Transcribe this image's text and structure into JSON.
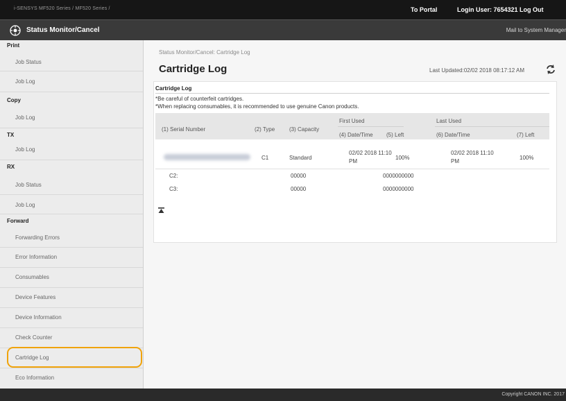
{
  "topbar": {
    "product": "i-SENSYS   MF520 Series / MF520 Series /",
    "portal": "To Portal",
    "login": "Login User:  7654321  Log Out"
  },
  "subbar": {
    "title": "Status Monitor/Cancel",
    "mail": "Mail to System Manager"
  },
  "sidebar": {
    "print": "Print",
    "print_job_status": "Job Status",
    "print_job_log": "Job Log",
    "copy": "Copy",
    "copy_job_log": "Job Log",
    "tx": "TX",
    "tx_job_log": "Job Log",
    "rx": "RX",
    "rx_job_status": "Job Status",
    "rx_job_log": "Job Log",
    "forward": "Forward",
    "forward_errors": "Forwarding Errors",
    "error_information": "Error Information",
    "consumables": "Consumables",
    "device_features": "Device Features",
    "device_information": "Device Information",
    "check_counter": "Check Counter",
    "cartridge_log": "Cartridge Log",
    "eco_information": "Eco Information"
  },
  "main": {
    "breadcrumb": "Status Monitor/Cancel: Cartridge Log",
    "title": "Cartridge Log",
    "last_updated": "Last Updated:02/02 2018 08:17:12 AM",
    "section_title": "Cartridge Log",
    "note1": "*Be careful of counterfeit cartridges.",
    "note2": "*When replacing consumables, it is recommended to use genuine Canon products."
  },
  "table": {
    "h_serial": "(1) Serial Number",
    "h_type": "(2) Type",
    "h_capacity": "(3) Capacity",
    "h_first_used": "First Used",
    "h_first_date": "(4) Date/Time",
    "h_first_left": "(5) Left",
    "h_last_used": "Last Used",
    "h_last_date": "(6) Date/Time",
    "h_last_left": "(7) Left",
    "row1": {
      "type": "C1",
      "capacity": "Standard",
      "first_date_l1": "02/02 2018 11:10",
      "first_date_l2": "PM",
      "first_left": "100%",
      "last_date_l1": "02/02 2018 11:10",
      "last_date_l2": "PM",
      "last_left": "100%"
    },
    "row2": {
      "label": "C2:",
      "capacity": "00000",
      "value": "0000000000"
    },
    "row3": {
      "label": "C3:",
      "capacity": "00000",
      "value": "0000000000"
    }
  },
  "footer": {
    "copyright": "Copyright CANON INC. 2017"
  },
  "colors": {
    "topbar": "#161616",
    "subbar": "#3a3a3a",
    "sidebar": "#ececec",
    "selected_outline": "#f0a30a",
    "footer": "#2a2a2a"
  },
  "icons": {
    "home": "home-icon",
    "refresh": "refresh-icon",
    "back_to_top": "back-to-top-icon"
  }
}
